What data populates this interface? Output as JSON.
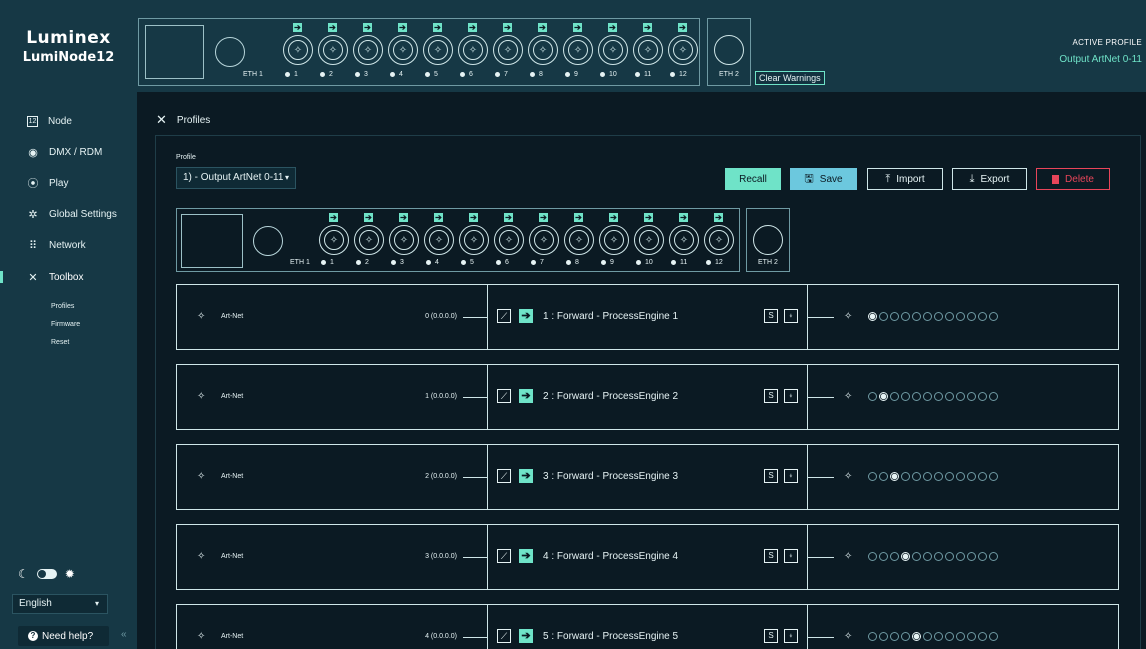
{
  "app": {
    "brand": "Luminex",
    "model": "LumiNode12"
  },
  "header": {
    "eth1_label": "ETH 1",
    "eth2_label": "ETH 2",
    "ports": [
      "1",
      "2",
      "3",
      "4",
      "5",
      "6",
      "7",
      "8",
      "9",
      "10",
      "11",
      "12"
    ],
    "clear_warnings": "Clear Warnings",
    "active_profile_label": "ACTIVE PROFILE",
    "active_profile_value": "Output ArtNet 0-11"
  },
  "sidebar": {
    "items": [
      {
        "icon": "node-icon",
        "glyph": "12",
        "label": "Node"
      },
      {
        "icon": "dmx-rdm-icon",
        "glyph": "◉",
        "label": "DMX / RDM"
      },
      {
        "icon": "play-icon",
        "glyph": "⦿",
        "label": "Play"
      },
      {
        "icon": "gear-icon",
        "glyph": "✲",
        "label": "Global Settings"
      },
      {
        "icon": "network-icon",
        "glyph": "⠿",
        "label": "Network"
      },
      {
        "icon": "toolbox-icon",
        "glyph": "✕",
        "label": "Toolbox"
      }
    ],
    "subitems": [
      "Profiles",
      "Firmware",
      "Reset"
    ],
    "language": "English",
    "help": "Need help?",
    "collapse": "«"
  },
  "main": {
    "title": "Profiles",
    "profile_label": "Profile",
    "profile_value": "1) - Output ArtNet 0-11",
    "buttons": {
      "recall": "Recall",
      "save": "Save",
      "import": "Import",
      "export": "Export",
      "delete": "Delete"
    },
    "rows": [
      {
        "source": "Art-Net",
        "universe": "0 (0.0.0.0)",
        "engine": "1 : Forward - ProcessEngine 1",
        "active_port": 1
      },
      {
        "source": "Art-Net",
        "universe": "1 (0.0.0.0)",
        "engine": "2 : Forward - ProcessEngine 2",
        "active_port": 2
      },
      {
        "source": "Art-Net",
        "universe": "2 (0.0.0.0)",
        "engine": "3 : Forward - ProcessEngine 3",
        "active_port": 3
      },
      {
        "source": "Art-Net",
        "universe": "3 (0.0.0.0)",
        "engine": "4 : Forward - ProcessEngine 4",
        "active_port": 4
      },
      {
        "source": "Art-Net",
        "universe": "4 (0.0.0.0)",
        "engine": "5 : Forward - ProcessEngine 5",
        "active_port": 5
      }
    ],
    "s_label": "S",
    "t_label": "⍖"
  },
  "colors": {
    "accent": "#6fe3c8",
    "save": "#6cc8de",
    "danger": "#e8455a",
    "sidebar": "#163845",
    "background": "#0b1a23"
  }
}
